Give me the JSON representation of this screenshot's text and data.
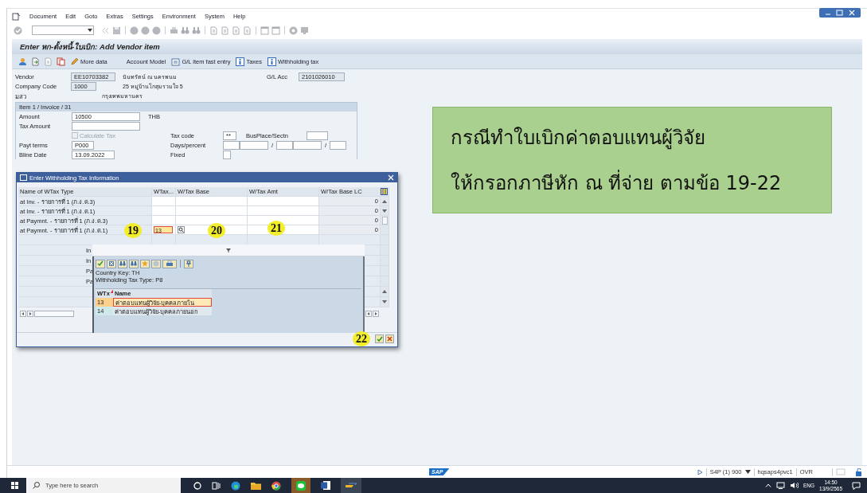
{
  "menu": [
    "Document",
    "Edit",
    "Goto",
    "Extras",
    "Settings",
    "Environment",
    "System",
    "Help"
  ],
  "screen_title": "Enter หก-ตั้งหนี้-ใบเบิก: Add Vendor item",
  "app_toolbar": [
    {
      "label": "More data"
    },
    {
      "label": "Account Model"
    },
    {
      "label": "G/L item fast entry"
    },
    {
      "label": "Taxes"
    },
    {
      "label": "Withholding tax"
    }
  ],
  "header": {
    "rows": [
      {
        "label": "Vendor",
        "value": "EE10703382",
        "info": "นันทรัตน์ ณ นครพนม"
      },
      {
        "label": "Company Code",
        "value": "1000",
        "info": "25 หมู่บ้านโกสุมรวมใจ 5"
      },
      {
        "label": "มสว",
        "info": "กรุงเทพมหานคร"
      }
    ],
    "gl_account": {
      "label": "G/L Acc",
      "value": "2101026010"
    }
  },
  "item": {
    "title": "Item 1 / Invoice / 31",
    "amount": {
      "label": "Amount",
      "value": "10500",
      "currency": "THB"
    },
    "tax_amount": {
      "label": "Tax Amount"
    },
    "calculate_tax": {
      "label": "Calculate Tax",
      "checked": false,
      "disabled": true
    },
    "tax_code": {
      "label": "Tax code",
      "value": "**"
    },
    "bus_place": {
      "label": "BusPlace/Sectn"
    },
    "payt_terms": {
      "label": "Payt terms",
      "value": "P000"
    },
    "days_percent": {
      "label": "Days/percent",
      "separators": [
        "/",
        "/"
      ]
    },
    "bline_date": {
      "label": "Bline Date",
      "value": "13.09.2022"
    },
    "fixed": {
      "label": "Fixed"
    }
  },
  "wtax_dialog": {
    "title": "Enter Withholding Tax Information",
    "columns": [
      "Name of WTax Type",
      "WTax...",
      "W/Tax Base",
      "W/Tax Amt",
      "W/Tax Base LC"
    ],
    "rows": [
      {
        "name": "at Inv. - รายการที่ 1 (ภ.ง.ด.3)",
        "base_lc": "0"
      },
      {
        "name": "at Inv. - รายการที่ 1 (ภ.ง.ด.1)",
        "base_lc": "0"
      },
      {
        "name": "at Paymnt. - รายการที่ 1 (ภ.ง.ด.3)",
        "base_lc": "0"
      },
      {
        "name": "at Paymnt. - รายการที่ 1 (ภ.ง.ด.1)",
        "code": "13",
        "base_lc": "0"
      }
    ],
    "covered_labels": [
      "In",
      "In",
      "Pa",
      "Pa"
    ]
  },
  "value_help": {
    "info": [
      "Country Key: TH",
      "Withholding Tax Type: P8"
    ],
    "columns": [
      "WTx",
      "Name"
    ],
    "rows": [
      {
        "code": "13",
        "name": "ค่าตอบแทนผู้วิจัย-บุคคลภายใน",
        "selected": true
      },
      {
        "code": "14",
        "name": "ค่าตอบแทนผู้วิจัย-บุคคลภายนอก",
        "selected": false
      }
    ]
  },
  "steps": [
    "19",
    "20",
    "21",
    "22"
  ],
  "note": {
    "lines": [
      "กรณีทำใบเบิกค่าตอบแทนผู้วิจัย",
      "ให้กรอกภาษีหัก ณ ที่จ่าย ตามข้อ 19-22"
    ]
  },
  "status_bar": {
    "logo": "SAP",
    "system": "S4P (1) 900",
    "server": "hqsaps4pvc1",
    "mode": "OVR"
  },
  "taskbar": {
    "search": {
      "placeholder": "Type here to search"
    },
    "language": "ENG",
    "time": "14:50",
    "date": "13/9/2565"
  }
}
